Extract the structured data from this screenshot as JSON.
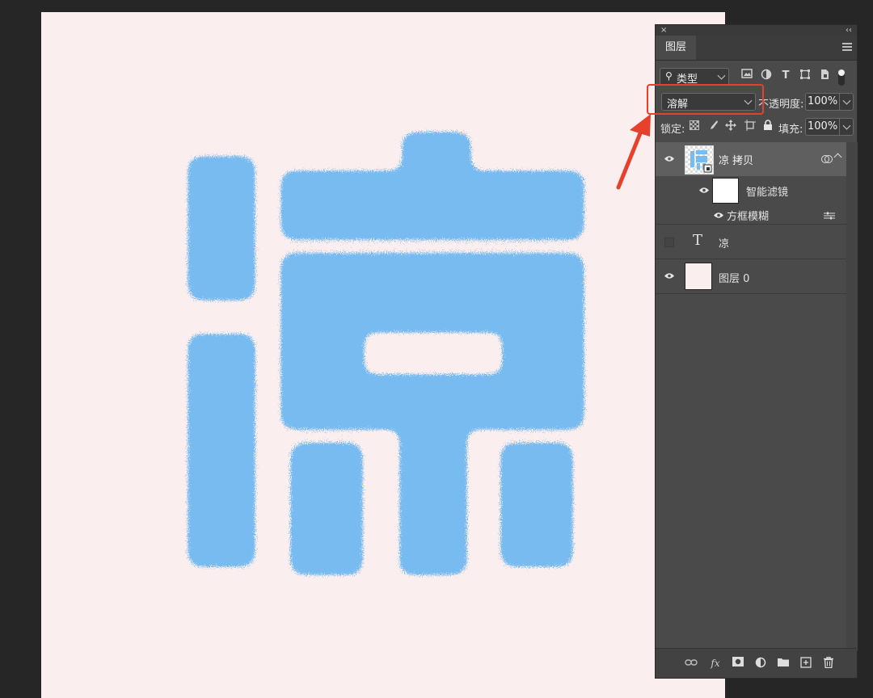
{
  "panel": {
    "close_glyph": "×",
    "collapse_glyph": "‹‹",
    "tab_label": "图层",
    "filter": {
      "search_glyph": "⚲",
      "label": "类型"
    },
    "blend_mode": {
      "value": "溶解"
    },
    "opacity": {
      "label": "不透明度:",
      "value": "100%"
    },
    "lock": {
      "label": "锁定:"
    },
    "fill": {
      "label": "填充:",
      "value": "100%"
    }
  },
  "layers": [
    {
      "name": "凉 拷贝",
      "visible": true,
      "selected": true
    },
    {
      "name": "智能滤镜",
      "visible": true
    },
    {
      "name": "方框模糊",
      "visible": true
    },
    {
      "name": "凉",
      "visible": false,
      "type_glyph": "T"
    },
    {
      "name": "图层 0",
      "visible": true
    }
  ],
  "colors": {
    "canvas_bg": "#fbeeee",
    "glyph_blue": "#78bbf0",
    "panel_bg": "#4a4a4a",
    "highlight_red": "#e8412b"
  },
  "icons": {
    "filter_type_text": "T",
    "fx": "fx"
  }
}
